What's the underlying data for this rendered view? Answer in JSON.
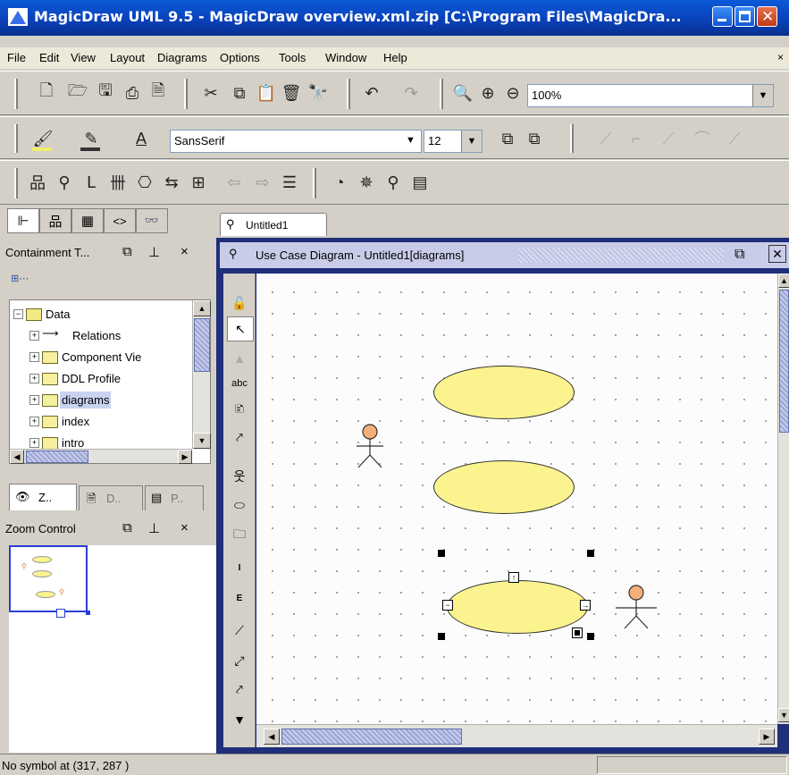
{
  "window": {
    "title": "MagicDraw UML 9.5 - MagicDraw overview.xml.zip [C:\\Program Files\\MagicDra..."
  },
  "menu": [
    "File",
    "Edit",
    "View",
    "Layout",
    "Diagrams",
    "Options",
    "Tools",
    "Window",
    "Help"
  ],
  "toolbar": {
    "zoom_value": "100%",
    "font_name": "SansSerif",
    "font_size": "12"
  },
  "left_tabs": [
    "Z..",
    "D..",
    "P.."
  ],
  "containment": {
    "title": "Containment T...",
    "root": "Data",
    "items": [
      "Relations",
      "Component Vie",
      "DDL Profile",
      "diagrams",
      "index",
      "intro"
    ],
    "selected": "diagrams"
  },
  "zoom_control": {
    "title": "Zoom Control"
  },
  "diagram": {
    "tab_label": "Untitled1",
    "window_title": "Use Case Diagram - Untitled1[diagrams]",
    "palette_labels": {
      "text": "abc",
      "include": "I",
      "extend": "E"
    }
  },
  "status": {
    "text": "No symbol at (317, 287 )"
  },
  "colors": {
    "titlebar": "#0a4fd0",
    "usecase_fill": "#fbf38e",
    "actor_head": "#f4b07a",
    "selection": "#c9d3f0"
  }
}
